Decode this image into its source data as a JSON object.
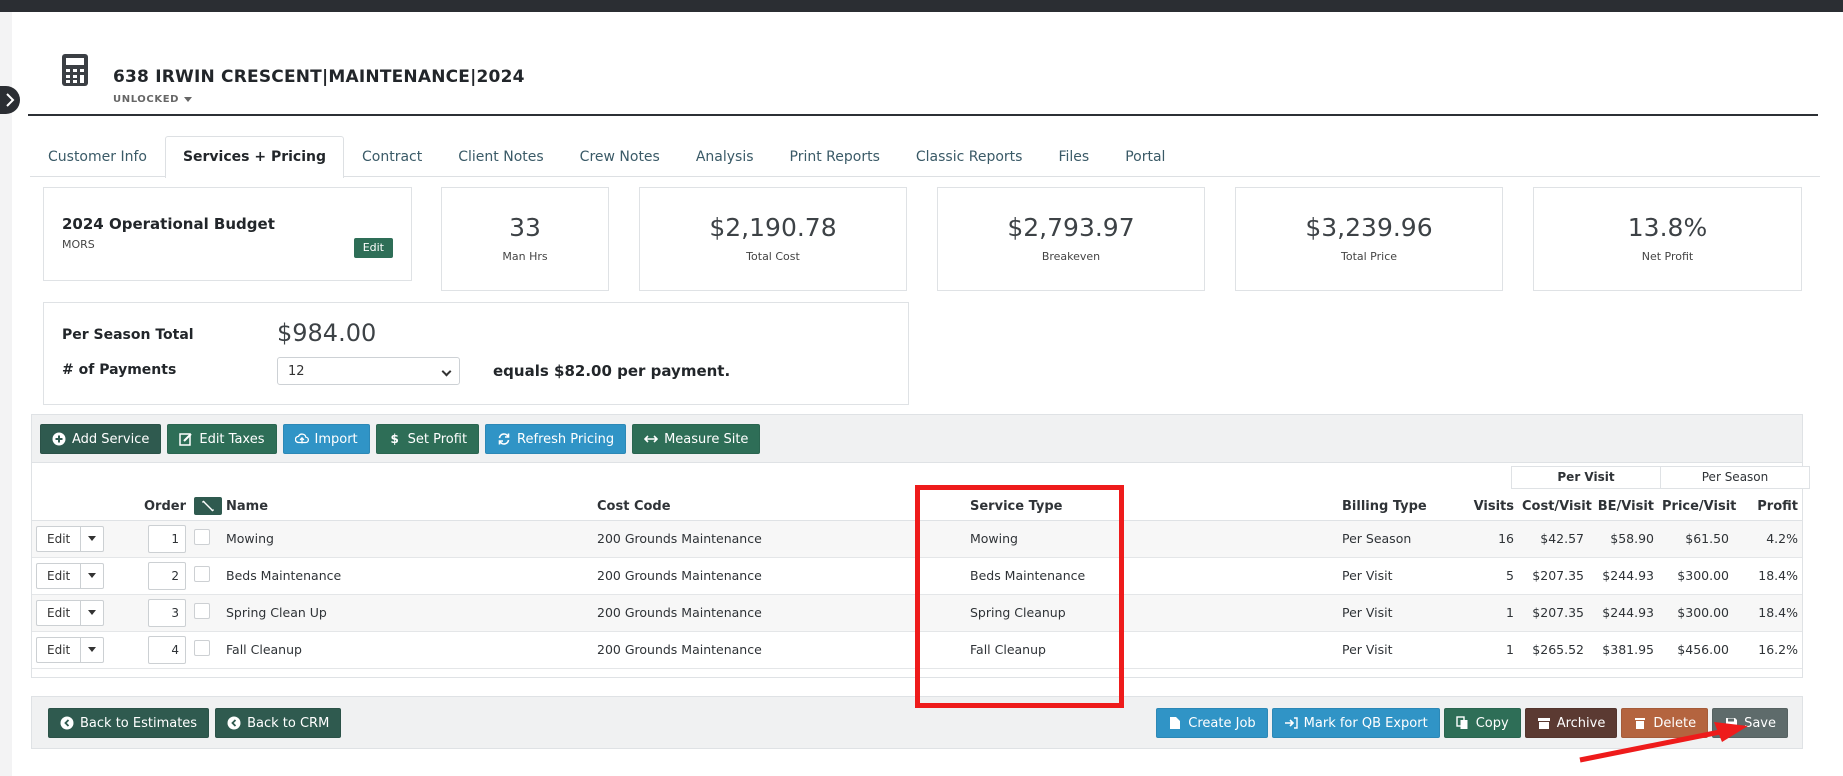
{
  "header": {
    "title": "638 IRWIN CRESCENT|MAINTENANCE|2024",
    "lock_status": "UNLOCKED"
  },
  "tabs": [
    {
      "label": "Customer Info"
    },
    {
      "label": "Services + Pricing",
      "active": true
    },
    {
      "label": "Contract"
    },
    {
      "label": "Client Notes"
    },
    {
      "label": "Crew Notes"
    },
    {
      "label": "Analysis"
    },
    {
      "label": "Print Reports"
    },
    {
      "label": "Classic Reports"
    },
    {
      "label": "Files"
    },
    {
      "label": "Portal"
    }
  ],
  "budget": {
    "title": "2024 Operational Budget",
    "subtitle": "MORS",
    "edit_label": "Edit"
  },
  "stats": [
    {
      "value": "33",
      "label": "Man Hrs"
    },
    {
      "value": "$2,190.78",
      "label": "Total Cost"
    },
    {
      "value": "$2,793.97",
      "label": "Breakeven"
    },
    {
      "value": "$3,239.96",
      "label": "Total Price"
    },
    {
      "value": "13.8%",
      "label": "Net Profit"
    }
  ],
  "season": {
    "total_label": "Per Season Total",
    "total_value": "$984.00",
    "payments_label": "# of Payments",
    "payments_selected": "12",
    "equals_text": "equals $82.00 per payment."
  },
  "toolbar": {
    "add_service": "Add Service",
    "edit_taxes": "Edit Taxes",
    "import": "Import",
    "set_profit": "Set Profit",
    "refresh_pricing": "Refresh Pricing",
    "measure_site": "Measure Site"
  },
  "group_headers": {
    "per_visit": "Per Visit",
    "per_season": "Per Season"
  },
  "table": {
    "columns": {
      "order": "Order",
      "name": "Name",
      "cost_code": "Cost Code",
      "service_type": "Service Type",
      "billing_type": "Billing Type",
      "visits": "Visits",
      "cost_visit": "Cost/Visit",
      "be_visit": "BE/Visit",
      "price_visit": "Price/Visit",
      "profit": "Profit"
    },
    "edit_label": "Edit",
    "rows": [
      {
        "order": "1",
        "name": "Mowing",
        "cost_code": "200 Grounds Maintenance",
        "service_type": "Mowing",
        "billing_type": "Per Season",
        "visits": "16",
        "cost_visit": "$42.57",
        "be_visit": "$58.90",
        "price_visit": "$61.50",
        "profit": "4.2%"
      },
      {
        "order": "2",
        "name": "Beds Maintenance",
        "cost_code": "200 Grounds Maintenance",
        "service_type": "Beds Maintenance",
        "billing_type": "Per Visit",
        "visits": "5",
        "cost_visit": "$207.35",
        "be_visit": "$244.93",
        "price_visit": "$300.00",
        "profit": "18.4%"
      },
      {
        "order": "3",
        "name": "Spring Clean Up",
        "cost_code": "200 Grounds Maintenance",
        "service_type": "Spring Cleanup",
        "billing_type": "Per Visit",
        "visits": "1",
        "cost_visit": "$207.35",
        "be_visit": "$244.93",
        "price_visit": "$300.00",
        "profit": "18.4%"
      },
      {
        "order": "4",
        "name": "Fall Cleanup",
        "cost_code": "200 Grounds Maintenance",
        "service_type": "Fall Cleanup",
        "billing_type": "Per Visit",
        "visits": "1",
        "cost_visit": "$265.52",
        "be_visit": "$381.95",
        "price_visit": "$456.00",
        "profit": "16.2%"
      }
    ]
  },
  "footer": {
    "back_estimates": "Back to Estimates",
    "back_crm": "Back to CRM",
    "create_job": "Create Job",
    "mark_qb": "Mark for QB Export",
    "copy": "Copy",
    "archive": "Archive",
    "delete": "Delete",
    "save": "Save"
  },
  "colors": {
    "dark_green": "#2f5a4f",
    "green": "#2e6e57",
    "blue": "#3094c6",
    "brown": "#5b3a32",
    "orange": "#b4643f",
    "annotation_red": "#ee1b1b"
  }
}
